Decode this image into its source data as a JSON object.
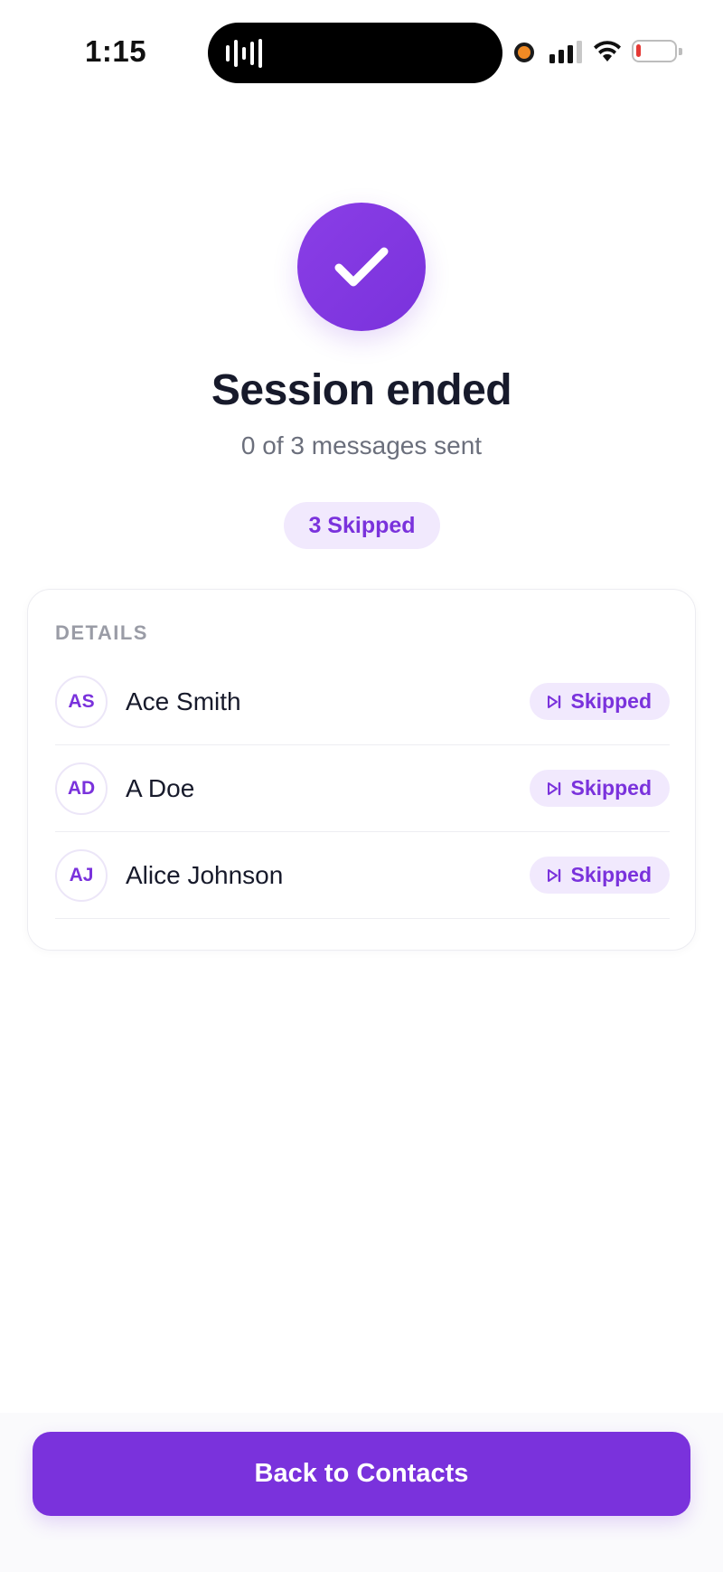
{
  "status_bar": {
    "time": "1:15",
    "battery_level": 0.12,
    "signal_bars": 3
  },
  "header": {
    "title": "Session ended",
    "subtitle": "0 of 3 messages sent",
    "summary_badge": "3 Skipped",
    "icon": "checkmark-icon"
  },
  "details": {
    "heading": "DETAILS",
    "contacts": [
      {
        "initials": "AS",
        "name": "Ace Smith",
        "status": "Skipped",
        "status_icon": "skip-icon"
      },
      {
        "initials": "AD",
        "name": "A Doe",
        "status": "Skipped",
        "status_icon": "skip-icon"
      },
      {
        "initials": "AJ",
        "name": "Alice Johnson",
        "status": "Skipped",
        "status_icon": "skip-icon"
      }
    ]
  },
  "footer": {
    "button_label": "Back to Contacts"
  },
  "colors": {
    "accent": "#7a32dc",
    "accent_light": "#f1e9fd",
    "text_primary": "#171a2b",
    "text_secondary": "#6b6f7c"
  }
}
